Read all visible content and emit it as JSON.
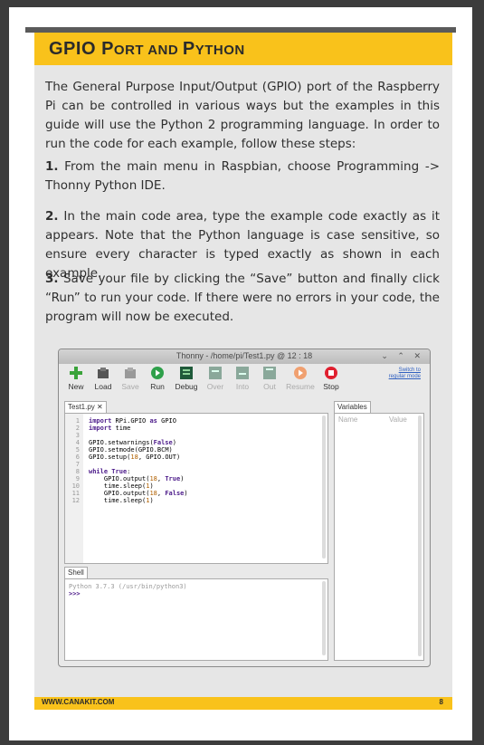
{
  "heading": {
    "first": "GPIO ",
    "p": "P",
    "ort": "ORT ",
    "and": "AND ",
    "py": "P",
    "ython": "YTHON"
  },
  "intro": "The General Purpose Input/Output (GPIO) port of the Raspberry Pi can be controlled in various ways but the examples in this guide will use the Python 2 programming language.  In order to run the code for each example, follow these steps:",
  "steps": [
    {
      "num": "1.",
      "text": " From the main menu in Raspbian, choose Programming -> Thonny Python IDE."
    },
    {
      "num": "2.",
      "text": " In the main code area, type the example code exactly as it appears. Note that the Python language is case sensitive, so ensure every character is typed exactly as shown in each example."
    },
    {
      "num": "3.",
      "text": " Save your file by clicking the “Save” button and finally click “Run” to run your code.  If there were no errors in your code, the program will now be executed."
    }
  ],
  "ide": {
    "title": "Thonny  -  /home/pi/Test1.py  @  12 : 18",
    "window_controls": "⌄ ⌃ ✕",
    "toolbar": [
      "New",
      "Load",
      "Save",
      "Run",
      "Debug",
      "Over",
      "Into",
      "Out",
      "Resume",
      "Stop"
    ],
    "switch_mode": "Switch to\nregular mode",
    "editor_tab": "Test1.py ✕",
    "code_lines": [
      "import RPi.GPIO as GPIO",
      "import time",
      "",
      "GPIO.setwarnings(False)",
      "GPIO.setmode(GPIO.BCM)",
      "GPIO.setup(18, GPIO.OUT)",
      "",
      "while True:",
      "    GPIO.output(18, True)",
      "    time.sleep(1)",
      "    GPIO.output(18, False)",
      "    time.sleep(1)"
    ],
    "line_numbers": [
      "1",
      "2",
      "3",
      "4",
      "5",
      "6",
      "7",
      "8",
      "9",
      "10",
      "11",
      "12"
    ],
    "variables_tab": "Variables",
    "variables_cols": [
      "Name",
      "Value"
    ],
    "shell_tab": "Shell",
    "shell_lines": [
      "Python 3.7.3 (/usr/bin/python3)",
      ">>>"
    ]
  },
  "footer": {
    "left": "WWW.CANAKIT.COM",
    "right": "8"
  },
  "colors": {
    "accent": "#f9c21b",
    "panel": "#e6e6e6",
    "keyword": "#4c1b8a",
    "number": "#b06000"
  }
}
